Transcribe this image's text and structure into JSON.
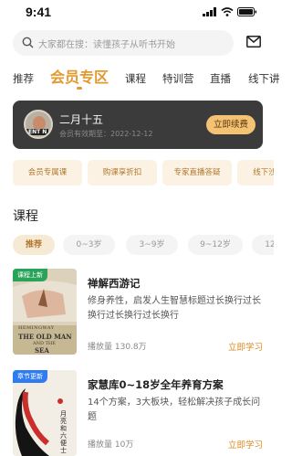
{
  "status_bar": {
    "time": "9:41"
  },
  "search": {
    "placeholder": "大家都在搜：读懂孩子从听书开始"
  },
  "tabs": [
    "推荐",
    "会员专区",
    "课程",
    "特训营",
    "直播",
    "线下讲"
  ],
  "member": {
    "name": "二月十五",
    "expiry": "会员有效期至：2022-12-12",
    "renew_label": "立即续费",
    "avatar_text": "ENT N"
  },
  "benefits": [
    "会员专属课",
    "购课享折扣",
    "专家直播答疑",
    "线下沙"
  ],
  "course_section": {
    "title": "课程",
    "age_filters": [
      "推荐",
      "0~3岁",
      "3~9岁",
      "9~12岁",
      "12"
    ]
  },
  "courses": [
    {
      "badge": "课程上新",
      "title": "禅解西游记",
      "description": "修身养性，启发人生智慧标题过长换行过长换行过长换行过长换行",
      "plays": "播放量 130.8万",
      "action": "立即学习",
      "cover_text": [
        "HEMINGWAY",
        "THE OLD MAN",
        "AND THE",
        "SEA"
      ]
    },
    {
      "badge": "章节更新",
      "title": "家慧库0~18岁全年养育方案",
      "description": "14个方案，3大板块，轻松解决孩子成长问题",
      "plays": "播放量 10万",
      "action": "立即学习",
      "cover_text": [
        "月亮和六便士"
      ]
    }
  ],
  "colors": {
    "accent": "#e29a2f",
    "member_card": "#3b3b3b",
    "renew_button": "#f3c272",
    "badge_new": "#2aa35a",
    "badge_update": "#2f7cf0"
  }
}
